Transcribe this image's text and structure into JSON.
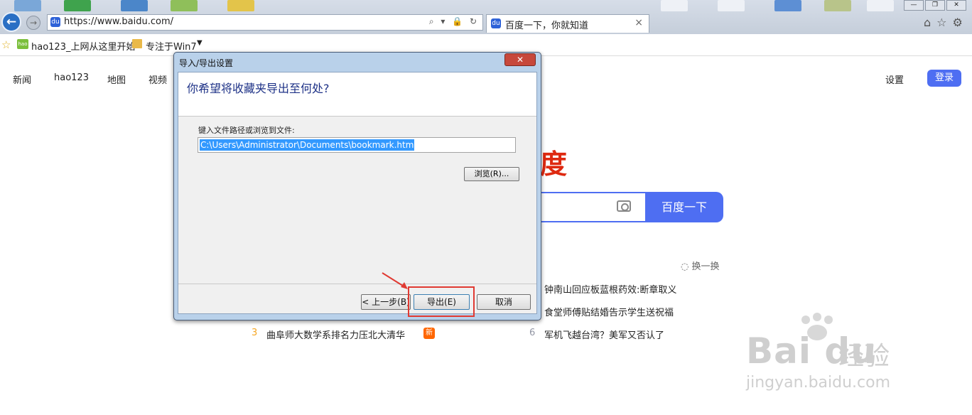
{
  "browser": {
    "url": "https://www.baidu.com/",
    "tab_title": "百度一下，你就知道",
    "tab_close": "×",
    "back_icon": "←",
    "fwd_icon": "→",
    "favicon": "du",
    "address_tools": "⌕ ▾ 🔒 ↻",
    "right_tools": "⌂☆⚙",
    "window_controls": [
      "—",
      "❐",
      "✕"
    ]
  },
  "favorites_bar": {
    "star": "☆",
    "hao_icon": "hao",
    "items": [
      "hao123_上网从这里开始",
      "专注于Win7"
    ],
    "dropdown": "▼"
  },
  "page": {
    "nav": [
      "新闻",
      "hao123",
      "地图",
      "视频"
    ],
    "settings": "设置",
    "login": "登录",
    "logo_tail": "度",
    "search_button": "百度一下",
    "refresh": "◌ 换一换",
    "hot": [
      {
        "num": "3",
        "text": "曲阜师大数学系排名力压北大清华",
        "num_color": "#f5a623"
      },
      {
        "num": "6",
        "text": "军机飞越台湾？美军又否认了",
        "num_color": "#9195a3"
      },
      {
        "num": "",
        "text": "钟南山回应板蓝根药效:断章取义"
      },
      {
        "num": "",
        "text": "食堂师傅贴结婚告示学生送祝福"
      }
    ],
    "new_badge": "新"
  },
  "watermark": {
    "logo": "Bai du",
    "cn": "经验",
    "url": "jingyan.baidu.com"
  },
  "dialog": {
    "title": "导入/导出设置",
    "close": "✕",
    "question": "你希望将收藏夹导出至何处?",
    "label": "键入文件路径或浏览到文件:",
    "path": "C:\\Users\\Administrator\\Documents\\bookmark.htm",
    "browse": "浏览(R)...",
    "prev": "< 上一步(B)",
    "export": "导出(E)",
    "cancel": "取消"
  }
}
